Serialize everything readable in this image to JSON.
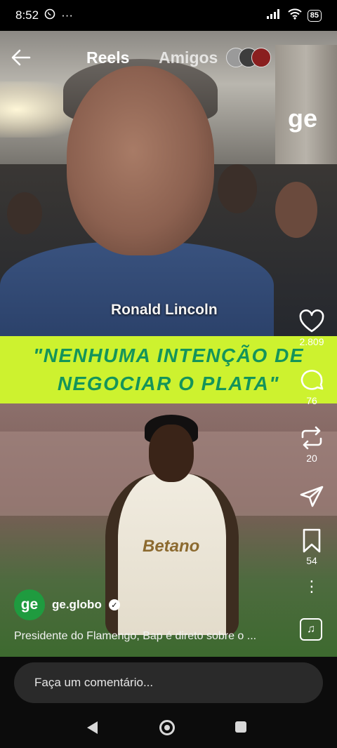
{
  "status": {
    "time": "8:52",
    "battery": "85"
  },
  "nav": {
    "tab_reels": "Reels",
    "tab_amigos": "Amigos"
  },
  "video": {
    "watermark": "ge",
    "speaker_name": "Ronald Lincoln",
    "headline_line1": "\"NENHUMA INTENÇÃO DE",
    "headline_line2": "NEGOCIAR O PLATA\"",
    "sponsor_text": "Betano"
  },
  "actions": {
    "likes": "2.809",
    "comments": "76",
    "reposts": "20",
    "saves": "54"
  },
  "post": {
    "avatar_text": "ge",
    "username": "ge.globo",
    "caption": "Presidente do Flamengo, Bap é direto sobre o ..."
  },
  "comment": {
    "placeholder": "Faça um comentário..."
  },
  "colors": {
    "banner_bg": "#cdf22f",
    "banner_text": "#14945a",
    "brand_green": "#1f9b3f"
  },
  "icons": [
    "back-arrow-icon",
    "heart-icon",
    "comment-icon",
    "repost-icon",
    "share-icon",
    "bookmark-icon",
    "more-icon",
    "music-icon"
  ]
}
